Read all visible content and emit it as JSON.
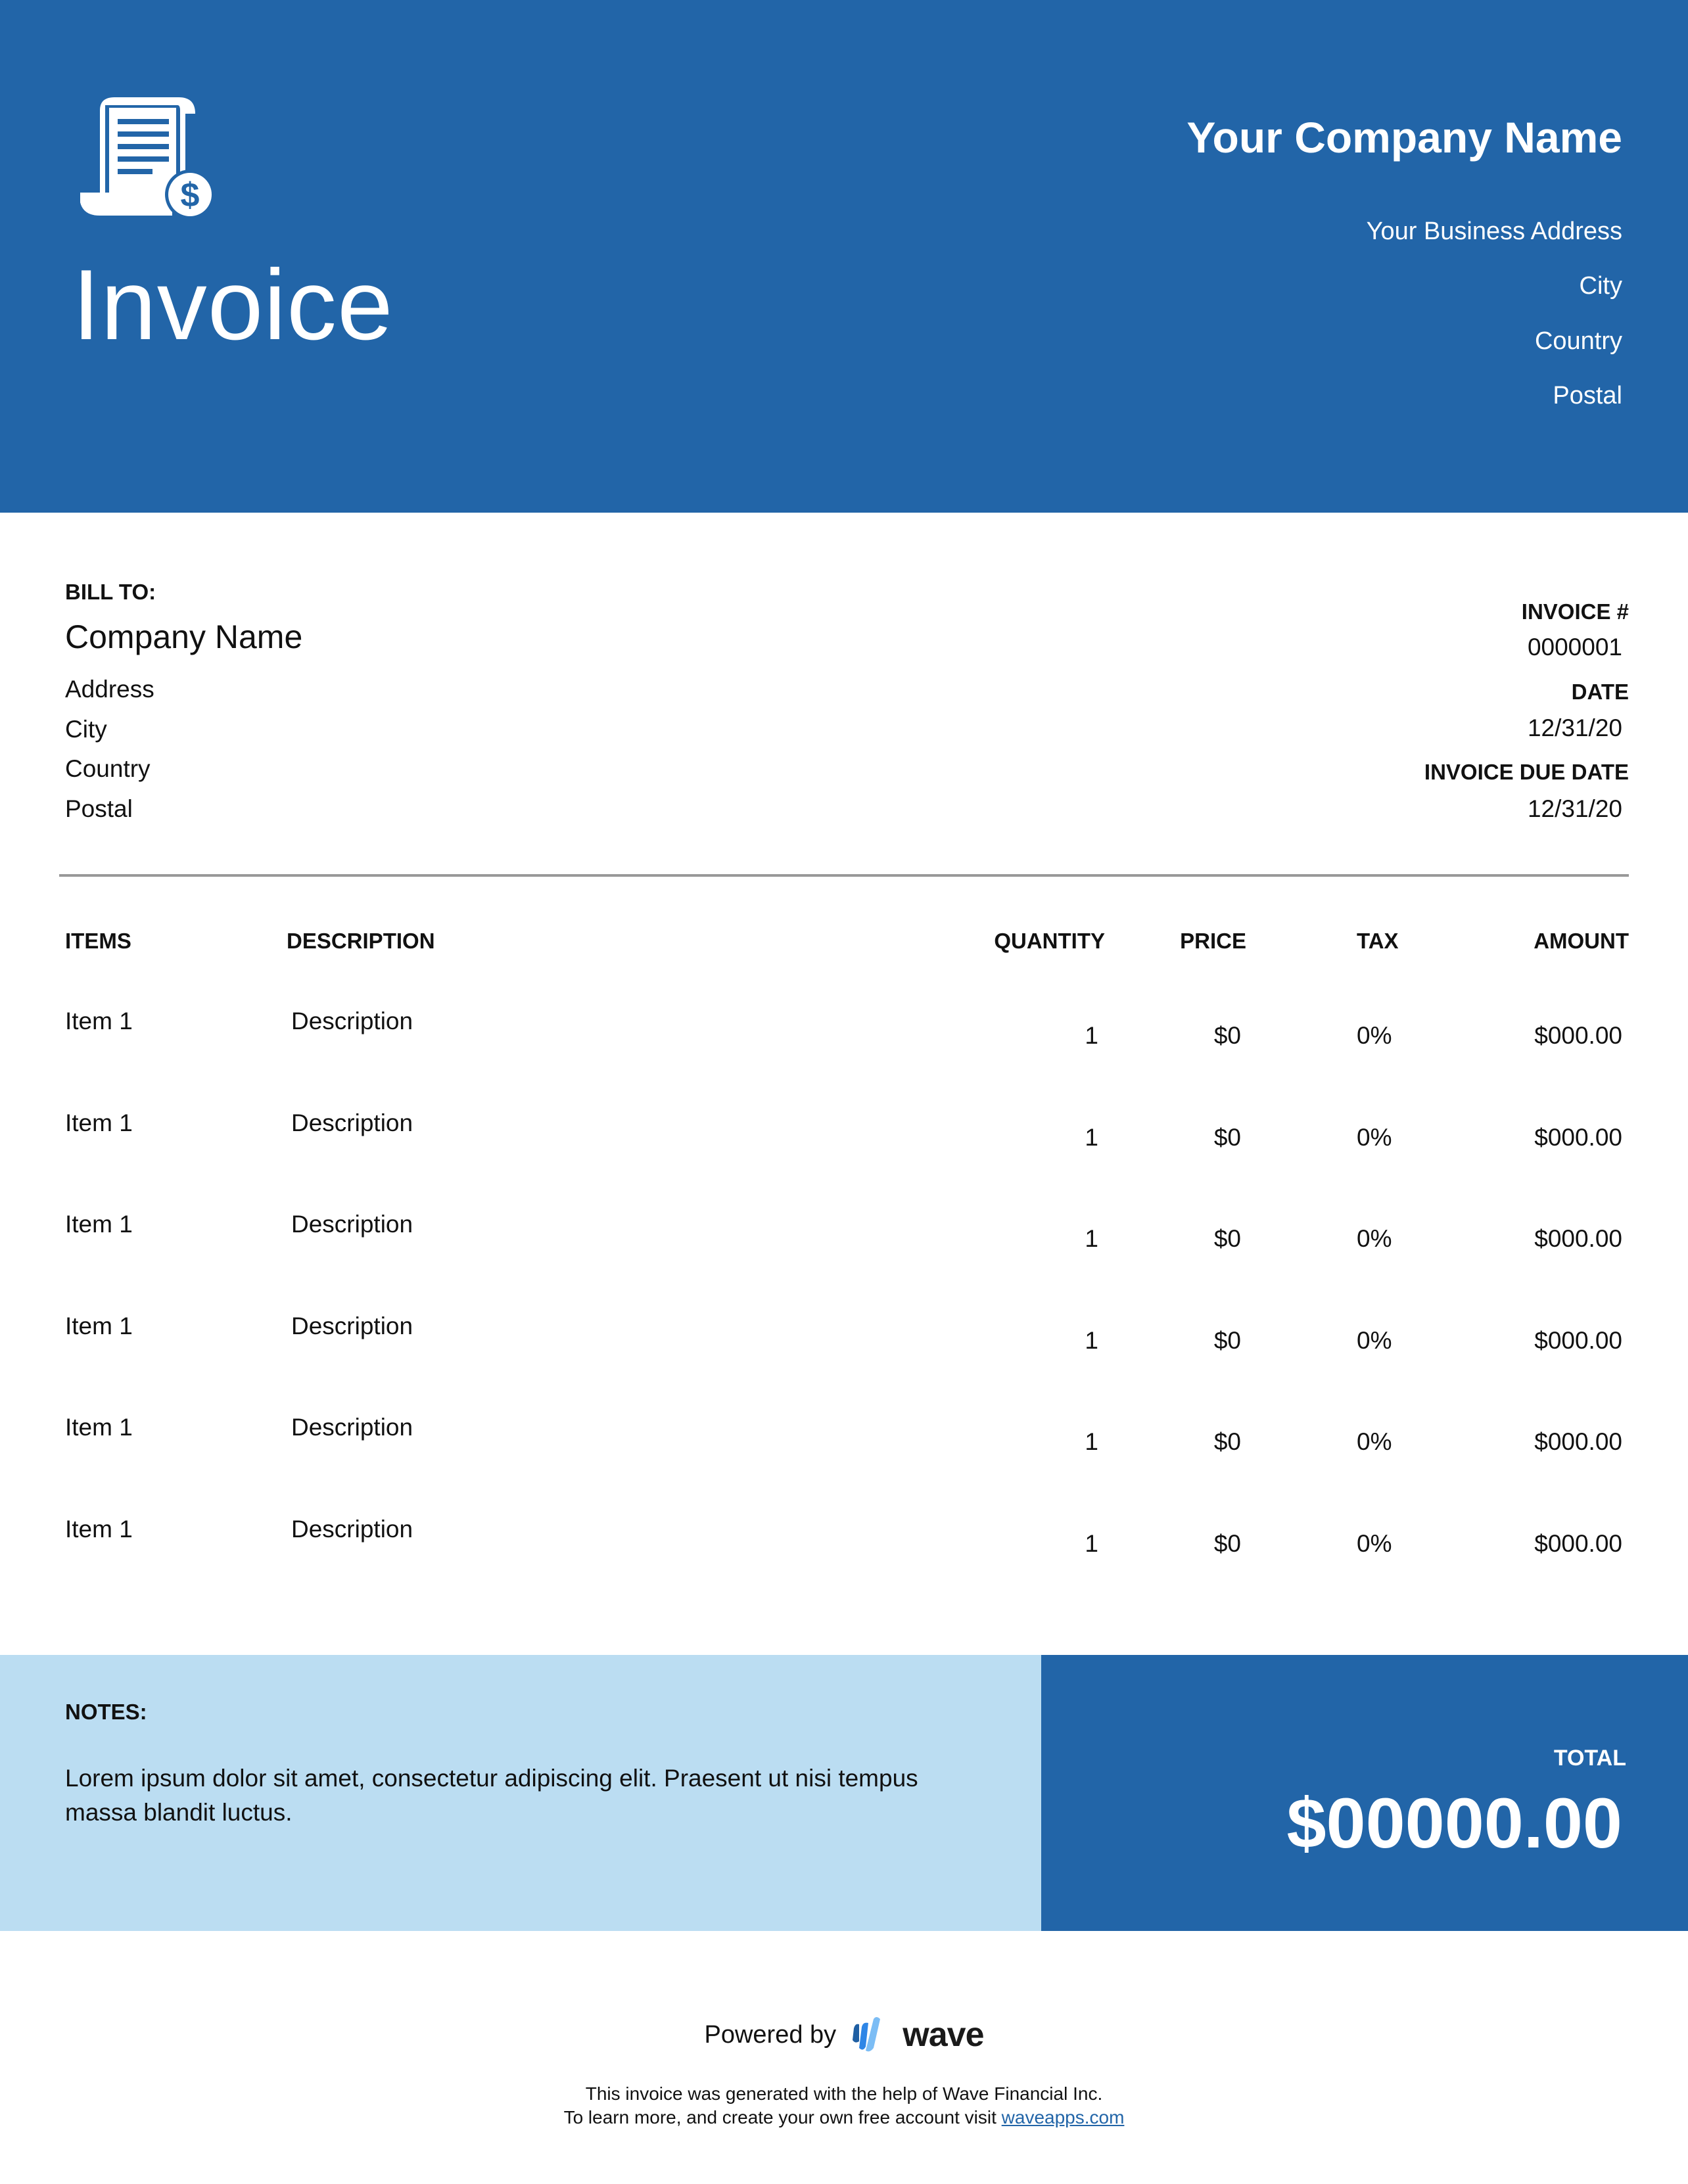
{
  "header": {
    "title": "Invoice",
    "icon": "invoice-receipt-dollar-icon",
    "company_name": "Your Company Name",
    "company_address_lines": [
      "Your Business Address",
      "City",
      "Country",
      "Postal"
    ]
  },
  "bill_to": {
    "label": "BILL TO:",
    "company": "Company Name",
    "lines": [
      "Address",
      "City",
      "Country",
      "Postal"
    ]
  },
  "meta": {
    "invoice_number_label": "INVOICE #",
    "invoice_number": "0000001",
    "date_label": "DATE",
    "date": "12/31/20",
    "due_date_label": "INVOICE DUE DATE",
    "due_date": "12/31/20"
  },
  "table": {
    "columns": [
      "ITEMS",
      "DESCRIPTION",
      "QUANTITY",
      "PRICE",
      "TAX",
      "AMOUNT"
    ],
    "rows": [
      {
        "item": "Item 1",
        "description": "Description",
        "quantity": "1",
        "price": "$0",
        "tax": "0%",
        "amount": "$000.00"
      },
      {
        "item": "Item 1",
        "description": "Description",
        "quantity": "1",
        "price": "$0",
        "tax": "0%",
        "amount": "$000.00"
      },
      {
        "item": "Item 1",
        "description": "Description",
        "quantity": "1",
        "price": "$0",
        "tax": "0%",
        "amount": "$000.00"
      },
      {
        "item": "Item 1",
        "description": "Description",
        "quantity": "1",
        "price": "$0",
        "tax": "0%",
        "amount": "$000.00"
      },
      {
        "item": "Item 1",
        "description": "Description",
        "quantity": "1",
        "price": "$0",
        "tax": "0%",
        "amount": "$000.00"
      },
      {
        "item": "Item 1",
        "description": "Description",
        "quantity": "1",
        "price": "$0",
        "tax": "0%",
        "amount": "$000.00"
      }
    ]
  },
  "notes": {
    "label": "NOTES:",
    "text": "Lorem ipsum dolor sit amet, consectetur adipiscing elit. Praesent ut nisi tempus massa blandit luctus."
  },
  "total": {
    "label": "TOTAL",
    "value": "$00000.00"
  },
  "footer": {
    "powered_by": "Powered by",
    "brand": "wave",
    "brand_icon": "wave-logo-icon",
    "line1": "This invoice was generated with the help of Wave Financial Inc.",
    "line2_prefix": "To learn more, and create your own free account visit ",
    "link_text": "waveapps.com"
  },
  "colors": {
    "primary": "#2265A8",
    "notes_bg": "#BBDDF2",
    "divider": "#999999"
  }
}
